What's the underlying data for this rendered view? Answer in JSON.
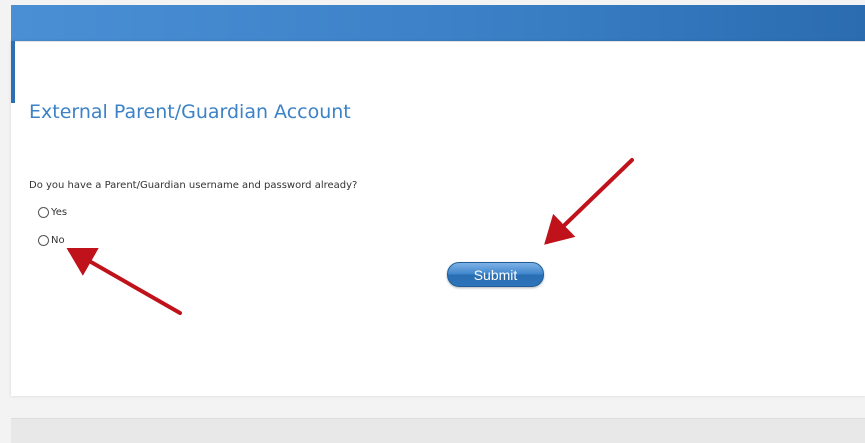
{
  "page": {
    "title": "External Parent/Guardian Account",
    "question": "Do you have a Parent/Guardian username and password already?"
  },
  "options": [
    {
      "label": "Yes",
      "selected": false
    },
    {
      "label": "No",
      "selected": false
    }
  ],
  "actions": {
    "submit_label": "Submit"
  },
  "colors": {
    "header": "#3d82c8",
    "title": "#3b82c6",
    "button": "#2d74ba",
    "annotation_arrow": "#c0121b"
  },
  "annotations": {
    "arrow_icon_1": "arrow-icon",
    "arrow_icon_2": "arrow-icon"
  }
}
